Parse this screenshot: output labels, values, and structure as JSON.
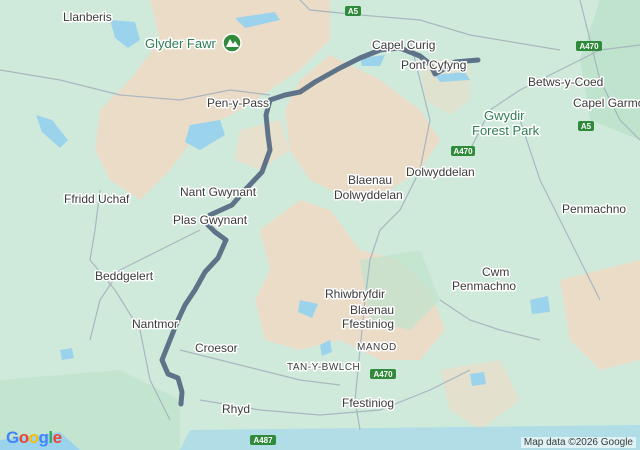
{
  "map": {
    "route_color": "#5f7388",
    "colors": {
      "land": "#cfeadb",
      "mountain": "#eddcc8",
      "water": "#9bd3ec",
      "road_shield": "#2f8a3a"
    },
    "peak_icon": "mountain-peak-icon",
    "peak_label": "Glyder Fawr",
    "park_label_line1": "Gwydir",
    "park_label_line2": "Forest Park",
    "places": {
      "llanberis": "Llanberis",
      "capel_curig": "Capel Curig",
      "pont_cyfyng": "Pont Cyfyng",
      "betws_y_coed": "Betws-y-Coed",
      "capel_garmo": "Capel Garmo",
      "pen_y_pass": "Pen-y-Pass",
      "dolwyddelan": "Dolwyddelan",
      "nant_gwynant": "Nant Gwynant",
      "blaenau_line1": "Blaenau",
      "blaenau_line2": "Dolwyddelan",
      "ffridd_uchaf": "Ffridd Uchaf",
      "plas_gwynant": "Plas Gwynant",
      "penmachno": "Penmachno",
      "beddgelert": "Beddgelert",
      "cwm_line1": "Cwm",
      "cwm_line2": "Penmachno",
      "rhiwbryfdir": "Rhiwbryfdir",
      "ffestiniog_line1": "Blaenau",
      "ffestiniog_line2": "Ffestiniog",
      "nantmor": "Nantmor",
      "croesor": "Croesor",
      "manod": "MANOD",
      "tan_y_bwlch": "TAN-Y-BWLCH",
      "rhyd": "Rhyd",
      "ffestiniog": "Ffestiniog"
    },
    "road_shields": {
      "a5_top": "A5",
      "a470_top": "A470",
      "a5_right": "A5",
      "a470_mid": "A470",
      "a470_low": "A470",
      "a487": "A487"
    },
    "logo": "Google",
    "attribution": "Map data ©2026 Google"
  }
}
